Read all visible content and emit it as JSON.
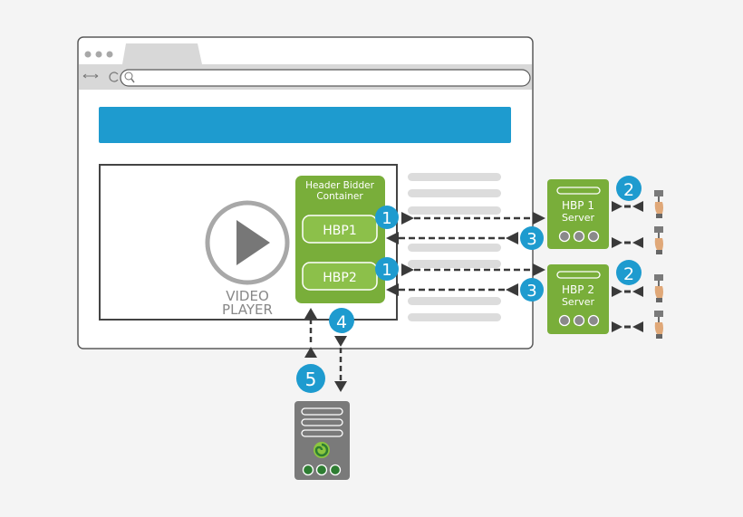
{
  "colors": {
    "background": "#f4f4f4",
    "browser_border": "#5a5a5a",
    "browser_chrome": "#d8d8d8",
    "banner": "#1e9bcf",
    "content_line": "#dcdcdc",
    "green": "#79ae3a",
    "green_light": "#8cc04a",
    "badge": "#1e9bcf",
    "arrow": "#3a3a3a",
    "server_gray": "#7a7a7a",
    "dot_gray": "#8a8a8a",
    "dot_green": "#2e7d32",
    "hand_skin": "#e0a878"
  },
  "browser": {
    "nav_arrows_icon": "left-right-arrows",
    "reload_icon": "reload",
    "search_icon": "magnifier",
    "address_value": ""
  },
  "video_player": {
    "line1": "VIDEO",
    "line2": "PLAYER",
    "icon": "play-button"
  },
  "container": {
    "title_line1": "Header Bidder",
    "title_line2": "Container",
    "slots": [
      {
        "label": "HBP1"
      },
      {
        "label": "HBP2"
      }
    ]
  },
  "servers": [
    {
      "line1": "HBP 1",
      "line2": "Server"
    },
    {
      "line1": "HBP 2",
      "line2": "Server"
    }
  ],
  "badges": {
    "request": "1",
    "auction": "2",
    "response": "3",
    "to_adserver": "4",
    "from_adserver": "5"
  },
  "ad_server": {
    "icon": "ad-server-logo"
  }
}
